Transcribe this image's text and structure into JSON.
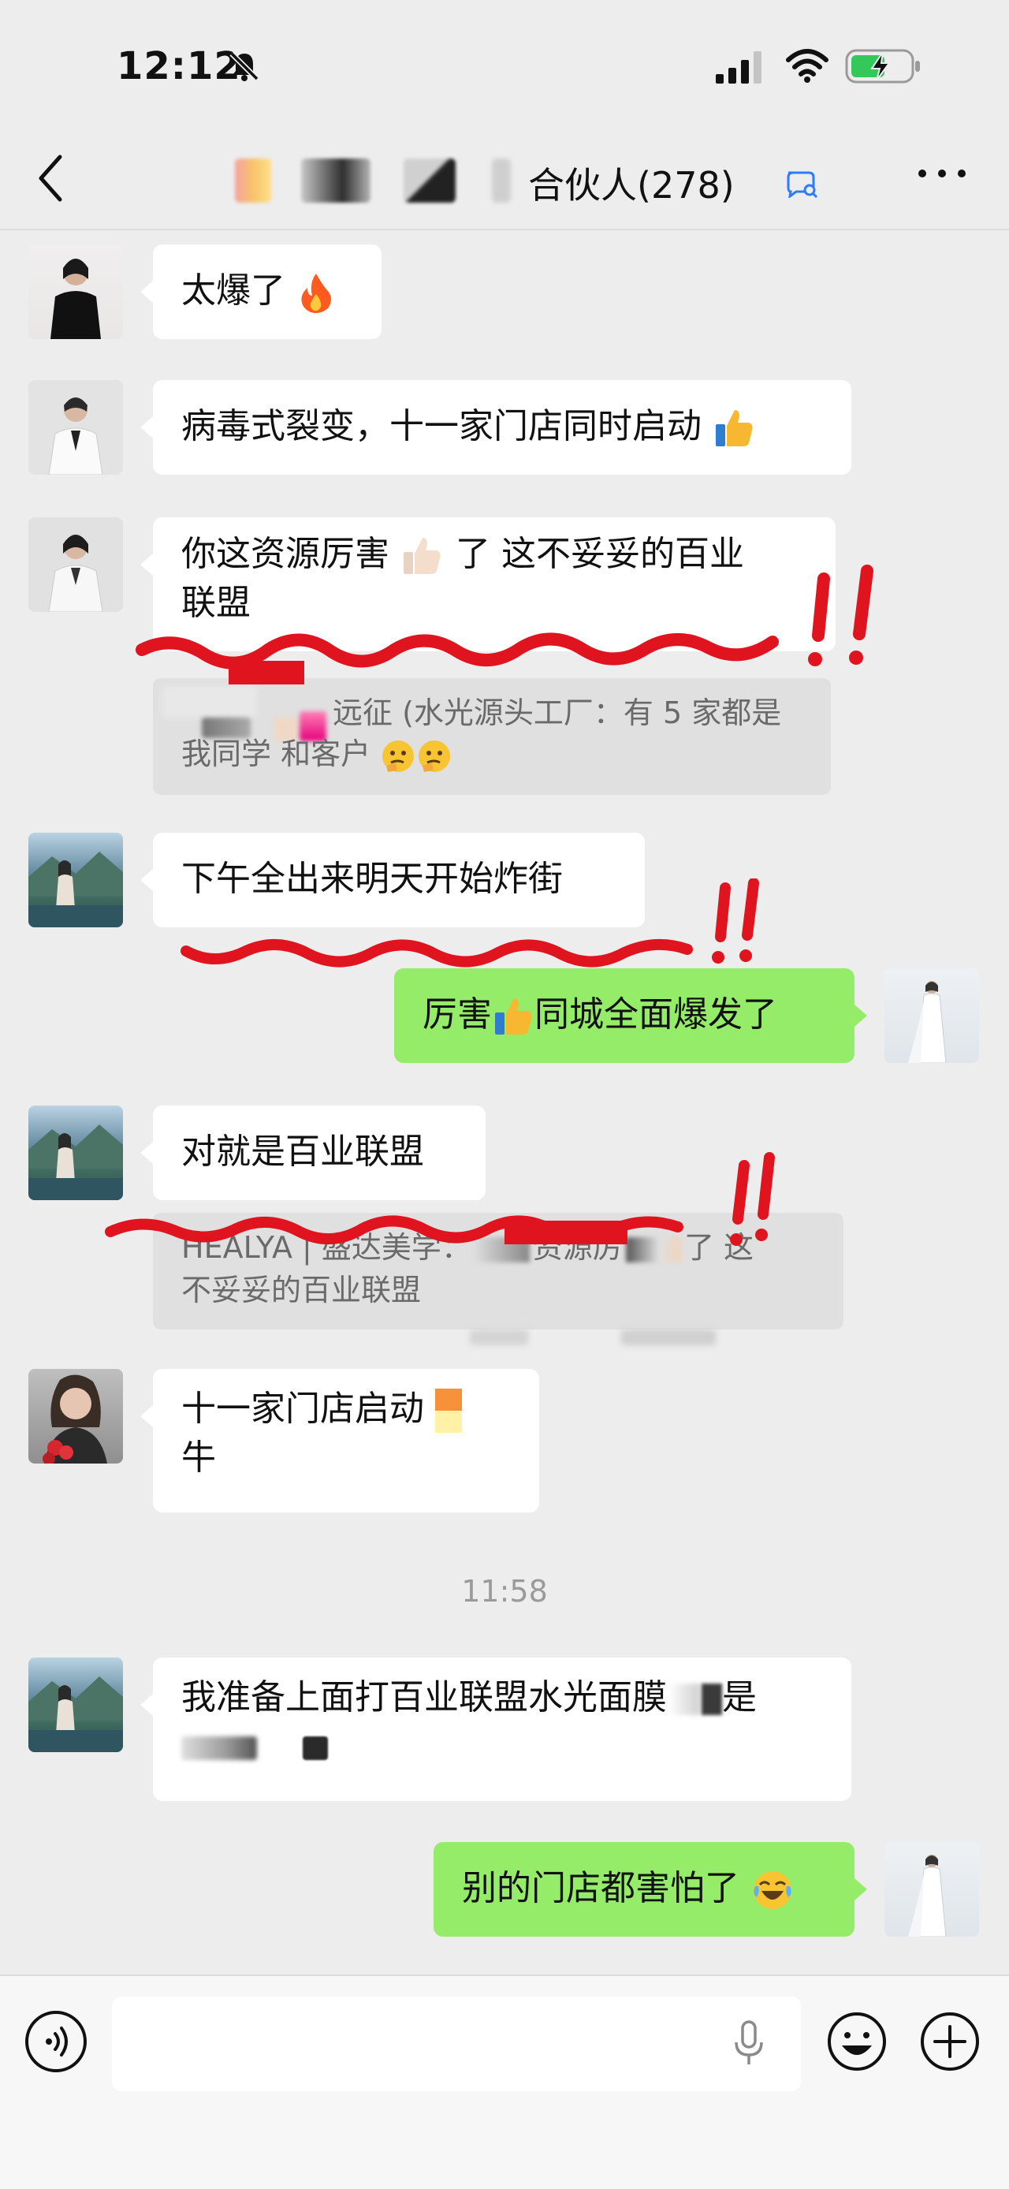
{
  "status_bar": {
    "time": "12:12"
  },
  "header": {
    "title_suffix": "合伙人(278)"
  },
  "messages": [
    {
      "text": "太爆了"
    },
    {
      "text": "病毒式裂变，十一家门店同时启动"
    },
    {
      "text_line1": "你这资源厉害",
      "text_line1b": "了  这不妥妥的百业",
      "text_line2": "联盟",
      "quote_line1": "远征 (水光源头工厂：有 5 家都是",
      "quote_line2": "我同学 和客户"
    },
    {
      "text": "下午全出来明天开始炸街"
    },
    {
      "text_a": "厉害",
      "text_b": "同城全面爆发了"
    },
    {
      "text": "对就是百业联盟",
      "quote_line1_a": "HEALYA | 盛达美学：",
      "quote_line1_b": "资源厉",
      "quote_line1_c": "了  这",
      "quote_line2": "不妥妥的百业联盟"
    },
    {
      "text_line1": "十一家门店启动",
      "text_line2": "牛"
    },
    {
      "text_line1": "我准备上面打百业联盟水光面膜",
      "text_line1b": "是"
    },
    {
      "text": "别的门店都害怕了"
    }
  ],
  "timestamp": "11:58",
  "icons": [
    "bell-slash-icon",
    "signal-icon",
    "wifi-icon",
    "battery-charging-icon",
    "back-icon",
    "chat-search-icon",
    "more-icon",
    "voice-icon",
    "mic-icon",
    "emoji-icon",
    "plus-icon",
    "fire-icon",
    "thumbs-up-icon",
    "laughing-icon"
  ],
  "colors": {
    "background": "#ededed",
    "bubble_self": "#95ec69",
    "bubble_other": "#ffffff",
    "annotation": "#e0141f"
  }
}
